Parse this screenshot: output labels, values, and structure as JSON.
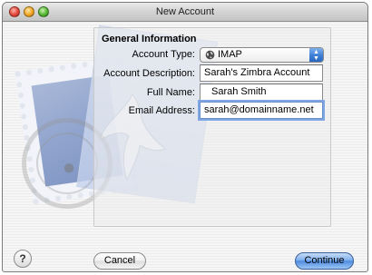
{
  "window": {
    "title": "New Account"
  },
  "form": {
    "section_title": "General Information",
    "account_type": {
      "label": "Account Type:",
      "value": "IMAP",
      "icon": "globe-icon"
    },
    "account_description": {
      "label": "Account Description:",
      "value": "Sarah's Zimbra Account"
    },
    "full_name": {
      "label": "Full Name:",
      "value": "Sarah Smith"
    },
    "email_address": {
      "label": "Email Address:",
      "value": "sarah@domainname.net"
    }
  },
  "buttons": {
    "help": "?",
    "cancel": "Cancel",
    "continue": "Continue"
  },
  "colors": {
    "accent": "#4f8be0",
    "focus_ring": "#7fa7e3",
    "stamp": "#8ea2cc"
  }
}
